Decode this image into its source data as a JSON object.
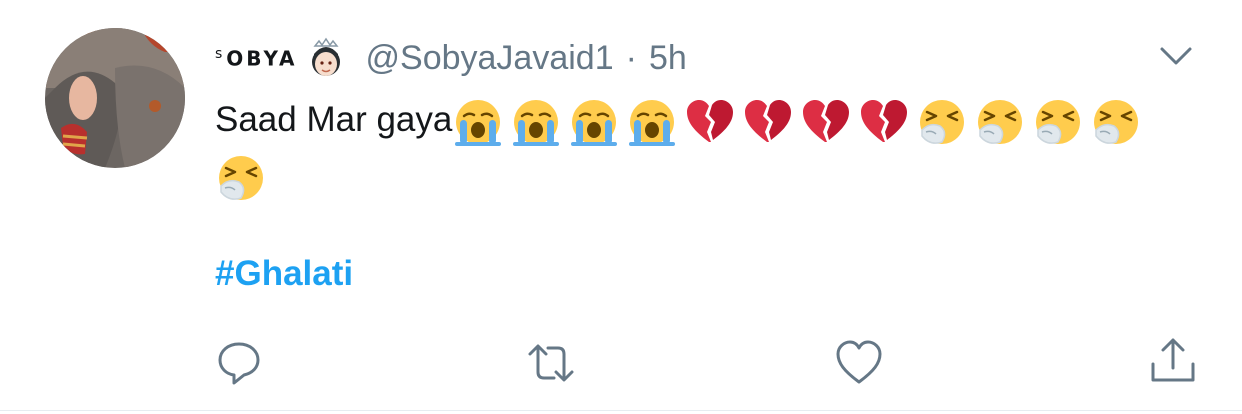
{
  "tweet": {
    "display_name_sup": "s",
    "display_name": "OBYA",
    "handle": "@SobyaJavaid1",
    "separator": "·",
    "time": "5h",
    "text": "Saad Mar gaya",
    "hashtag": "#Ghalati",
    "emoji_sequence": [
      "crying-face",
      "crying-face",
      "crying-face",
      "crying-face",
      "broken-heart",
      "broken-heart",
      "broken-heart",
      "broken-heart",
      "sneezing-face",
      "sneezing-face",
      "sneezing-face",
      "sneezing-face",
      "sneezing-face"
    ],
    "name_badge_icon": "princess-emoji-icon",
    "colors": {
      "hashtag": "#1da1f2",
      "secondary_text": "#657786",
      "action_icon": "#657786"
    }
  },
  "actions": [
    {
      "name": "reply",
      "icon": "reply-icon"
    },
    {
      "name": "retweet",
      "icon": "retweet-icon"
    },
    {
      "name": "like",
      "icon": "heart-icon"
    },
    {
      "name": "share",
      "icon": "share-icon"
    }
  ]
}
